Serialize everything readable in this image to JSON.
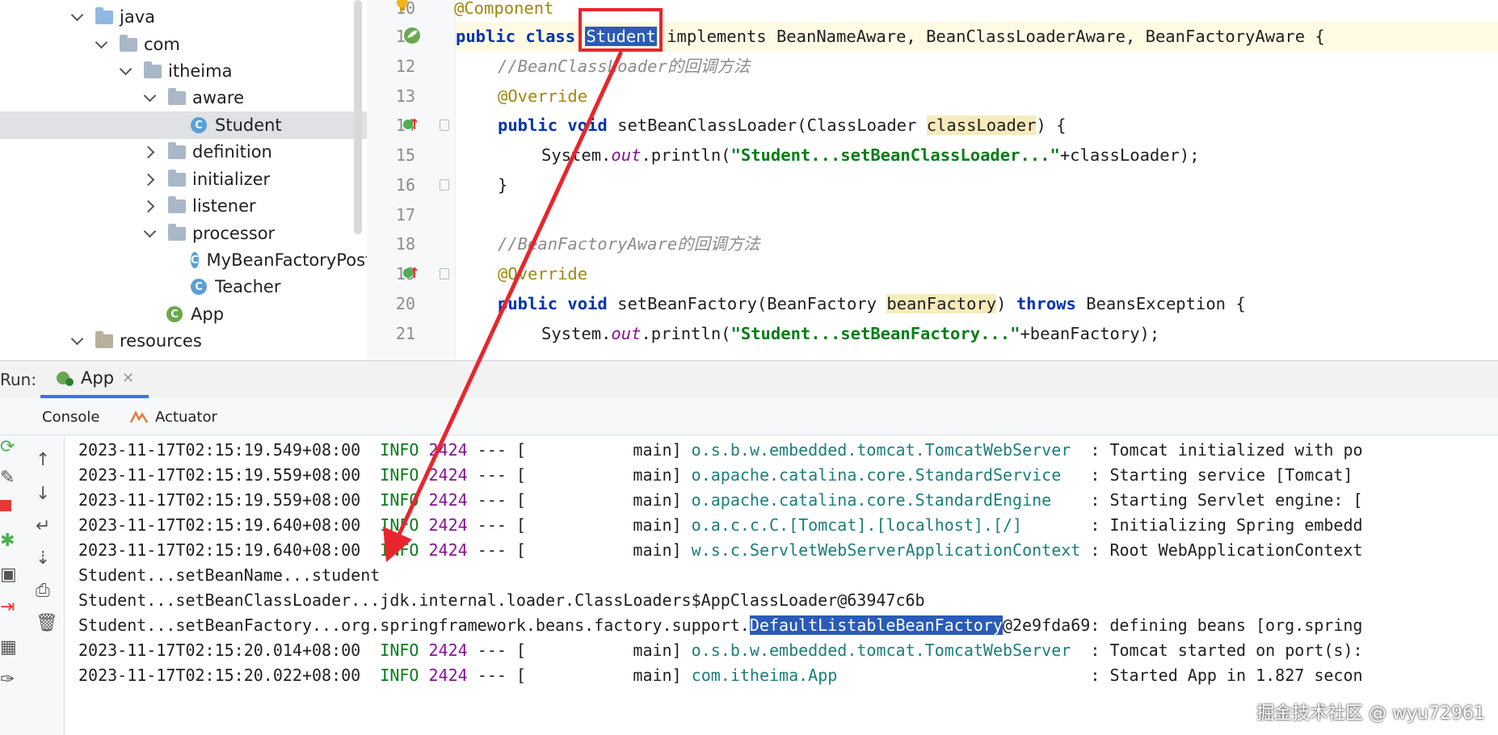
{
  "project_tree": {
    "items": [
      {
        "label": "java",
        "icon": "source-folder-icon",
        "expanded": true
      },
      {
        "label": "com",
        "icon": "package-icon",
        "expanded": true
      },
      {
        "label": "itheima",
        "icon": "package-icon",
        "expanded": true
      },
      {
        "label": "aware",
        "icon": "package-icon",
        "expanded": true
      },
      {
        "label": "Student",
        "icon": "class-icon",
        "selected": true
      },
      {
        "label": "definition",
        "icon": "package-icon",
        "expanded": false
      },
      {
        "label": "initializer",
        "icon": "package-icon",
        "expanded": false
      },
      {
        "label": "listener",
        "icon": "package-icon",
        "expanded": false
      },
      {
        "label": "processor",
        "icon": "package-icon",
        "expanded": true
      },
      {
        "label": "MyBeanFactoryPost",
        "icon": "class-icon"
      },
      {
        "label": "Teacher",
        "icon": "class-icon"
      },
      {
        "label": "App",
        "icon": "spring-boot-class-icon"
      },
      {
        "label": "resources",
        "icon": "resources-folder-icon",
        "expanded": true
      }
    ]
  },
  "editor": {
    "line_numbers": [
      "10",
      "11",
      "12",
      "13",
      "14",
      "15",
      "16",
      "17",
      "18",
      "19",
      "20",
      "21"
    ],
    "lines": {
      "l10": "@Component",
      "l11_kw": "public class ",
      "l11_cls": "Student",
      "l11_rest": " implements BeanNameAware, BeanClassLoaderAware, BeanFactoryAware {",
      "l12": "//BeanClassLoader的回调方法",
      "l13": "@Override",
      "l14_kw": "public void ",
      "l14_sig": "setBeanClassLoader(ClassLoader ",
      "l14_param": "classLoader",
      "l14_end": ") {",
      "l15_a": "System.",
      "l15_out": "out",
      "l15_b": ".println(",
      "l15_str": "\"Student...setBeanClassLoader...\"",
      "l15_c": "+classLoader);",
      "l16": "}",
      "l18": "//BeanFactoryAware的回调方法",
      "l19": "@Override",
      "l20_kw": "public void ",
      "l20_sig": "setBeanFactory(BeanFactory ",
      "l20_param": "beanFactory",
      "l20_mid": ") ",
      "l20_throws": "throws",
      "l20_end": " BeansException {",
      "l21_a": "System.",
      "l21_out": "out",
      "l21_b": ".println(",
      "l21_str": "\"Student...setBeanFactory...\"",
      "l21_c": "+beanFactory);"
    }
  },
  "run": {
    "label": "Run:",
    "tab": "App",
    "subtabs": {
      "console": "Console",
      "actuator": "Actuator"
    },
    "console_lines": [
      {
        "ts": "2023-11-17T02:15:19.549+08:00",
        "level": "INFO",
        "pid": "2424",
        "sep": "--- [",
        "thread": "main]",
        "logger": "o.s.b.w.embedded.tomcat.TomcatWebServer",
        "msg": ": Tomcat initialized with po"
      },
      {
        "ts": "2023-11-17T02:15:19.559+08:00",
        "level": "INFO",
        "pid": "2424",
        "sep": "--- [",
        "thread": "main]",
        "logger": "o.apache.catalina.core.StandardService",
        "msg": ": Starting service [Tomcat]"
      },
      {
        "ts": "2023-11-17T02:15:19.559+08:00",
        "level": "INFO",
        "pid": "2424",
        "sep": "--- [",
        "thread": "main]",
        "logger": "o.apache.catalina.core.StandardEngine",
        "msg": ": Starting Servlet engine: ["
      },
      {
        "ts": "2023-11-17T02:15:19.640+08:00",
        "level": "INFO",
        "pid": "2424",
        "sep": "--- [",
        "thread": "main]",
        "logger": "o.a.c.c.C.[Tomcat].[localhost].[/]",
        "msg": ": Initializing Spring embedd"
      },
      {
        "ts": "2023-11-17T02:15:19.640+08:00",
        "level": "INFO",
        "pid": "2424",
        "sep": "--- [",
        "thread": "main]",
        "logger": "w.s.c.ServletWebServerApplicationContext",
        "msg": ": Root WebApplicationContext"
      }
    ],
    "plain_lines": {
      "p1": "Student...setBeanName...student",
      "p2": "Student...setBeanClassLoader...jdk.internal.loader.ClassLoaders$AppClassLoader@63947c6b",
      "p3_a": "Student...setBeanFactory...org.springframework.beans.factory.support.",
      "p3_sel": "DefaultListableBeanFactory",
      "p3_b": "@2e9fda69: defining beans [org.spring"
    },
    "console_lines2": [
      {
        "ts": "2023-11-17T02:15:20.014+08:00",
        "level": "INFO",
        "pid": "2424",
        "sep": "--- [",
        "thread": "main]",
        "logger": "o.s.b.w.embedded.tomcat.TomcatWebServer",
        "msg": ": Tomcat started on port(s):"
      },
      {
        "ts": "2023-11-17T02:15:20.022+08:00",
        "level": "INFO",
        "pid": "2424",
        "sep": "--- [",
        "thread": "main]",
        "logger": "com.itheima.App",
        "msg": ": Started App in 1.827 secon"
      }
    ]
  },
  "watermark": "掘金技术社区 @ wyu72961",
  "colors": {
    "annotation_red": "#e8252d",
    "selection_blue": "#2a5bb8",
    "current_line": "#fffae3"
  }
}
